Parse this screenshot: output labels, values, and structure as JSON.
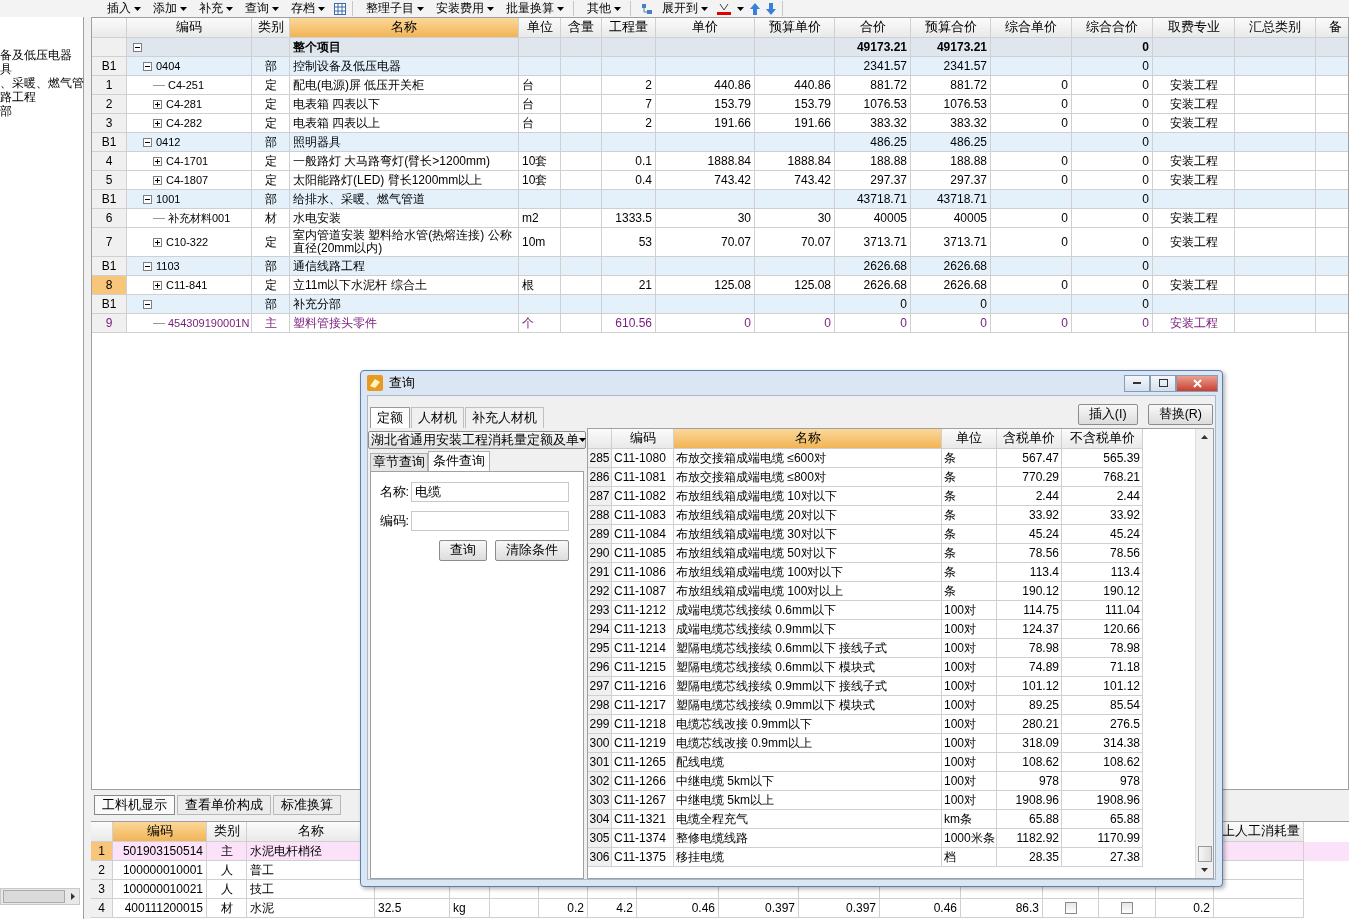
{
  "toolbar": {
    "groups": [
      [
        {
          "label": "插入",
          "dropdown": true
        },
        {
          "label": "添加",
          "dropdown": true
        },
        {
          "label": "补充",
          "dropdown": true
        },
        {
          "label": "查询",
          "dropdown": true
        },
        {
          "label": "存档",
          "dropdown": true
        }
      ],
      [
        {
          "label": "整理子目",
          "dropdown": true
        },
        {
          "label": "安装费用",
          "dropdown": true
        },
        {
          "label": "批量换算",
          "dropdown": true
        }
      ],
      [
        {
          "label": "其他",
          "dropdown": true
        }
      ],
      [
        {
          "label": "展开到",
          "dropdown": true
        }
      ]
    ]
  },
  "tree_panel": {
    "items": [
      "备及低压电器",
      "具",
      "、采暖、燃气管",
      "路工程",
      "部"
    ]
  },
  "estimate_table": {
    "columns": [
      {
        "label": "编码",
        "selected": false
      },
      {
        "label": "类别",
        "selected": false
      },
      {
        "label": "名称",
        "selected": true
      },
      {
        "label": "单位",
        "selected": false
      },
      {
        "label": "含量",
        "selected": false
      },
      {
        "label": "工程量",
        "selected": false
      },
      {
        "label": "单价",
        "selected": false
      },
      {
        "label": "预算单价",
        "selected": false
      },
      {
        "label": "合价",
        "selected": false
      },
      {
        "label": "预算合价",
        "selected": false
      },
      {
        "label": "综合单价",
        "selected": false
      },
      {
        "label": "综合合价",
        "selected": false
      },
      {
        "label": "取费专业",
        "selected": false
      },
      {
        "label": "汇总类别",
        "selected": false
      },
      {
        "label": "备",
        "selected": false
      }
    ],
    "root": {
      "kind": "total",
      "expanded": true,
      "selected": false,
      "name": "整个项目",
      "amount": "49173.21",
      "budget_amount": "49173.21",
      "comp_amount": "0",
      "children": [
        {
          "kind": "section",
          "row_no": "B1",
          "code": "0404",
          "type": "部",
          "name": "控制设备及低压电器",
          "expanded": true,
          "selected": false,
          "amount": "2341.57",
          "budget_amount": "2341.57",
          "comp_amount": "0",
          "children": [
            {
              "kind": "item",
              "row_no": "1",
              "code": "C4-251",
              "type": "定",
              "name": "配电(电源)屏 低压开关柜",
              "unit": "台",
              "qty": "2",
              "price": "440.86",
              "budget_price": "440.86",
              "amount": "881.72",
              "budget_amount": "881.72",
              "comp_price": "0",
              "comp_amount": "0",
              "fee": "安装工程",
              "selected": false
            },
            {
              "kind": "item",
              "row_no": "2",
              "code": "C4-281",
              "type": "定",
              "name": "电表箱 四表以下",
              "unit": "台",
              "qty": "7",
              "price": "153.79",
              "budget_price": "153.79",
              "amount": "1076.53",
              "budget_amount": "1076.53",
              "comp_price": "0",
              "comp_amount": "0",
              "fee": "安装工程",
              "expanded": false,
              "selected": false
            },
            {
              "kind": "item",
              "row_no": "3",
              "code": "C4-282",
              "type": "定",
              "name": "电表箱 四表以上",
              "unit": "台",
              "qty": "2",
              "price": "191.66",
              "budget_price": "191.66",
              "amount": "383.32",
              "budget_amount": "383.32",
              "comp_price": "0",
              "comp_amount": "0",
              "fee": "安装工程",
              "expanded": false,
              "selected": false
            }
          ]
        },
        {
          "kind": "section",
          "row_no": "B1",
          "code": "0412",
          "type": "部",
          "name": "照明器具",
          "expanded": true,
          "selected": false,
          "amount": "486.25",
          "budget_amount": "486.25",
          "comp_amount": "0",
          "children": [
            {
              "kind": "item",
              "row_no": "4",
              "code": "C4-1701",
              "type": "定",
              "name": "一般路灯 大马路弯灯(臂长>1200mm)",
              "unit": "10套",
              "qty": "0.1",
              "price": "1888.84",
              "budget_price": "1888.84",
              "amount": "188.88",
              "budget_amount": "188.88",
              "comp_price": "0",
              "comp_amount": "0",
              "fee": "安装工程",
              "expanded": false,
              "selected": false
            },
            {
              "kind": "item",
              "row_no": "5",
              "code": "C4-1807",
              "type": "定",
              "name": "太阳能路灯(LED) 臂长1200mm以上",
              "unit": "10套",
              "qty": "0.4",
              "price": "743.42",
              "budget_price": "743.42",
              "amount": "297.37",
              "budget_amount": "297.37",
              "comp_price": "0",
              "comp_amount": "0",
              "fee": "安装工程",
              "expanded": false,
              "selected": false
            }
          ]
        },
        {
          "kind": "section",
          "row_no": "B1",
          "code": "1001",
          "type": "部",
          "name": "给排水、采暖、燃气管道",
          "expanded": true,
          "selected": false,
          "amount": "43718.71",
          "budget_amount": "43718.71",
          "comp_amount": "0",
          "children": [
            {
              "kind": "item",
              "row_no": "6",
              "code": "补充材料001",
              "type": "材",
              "name": "水电安装",
              "unit": "m2",
              "qty": "1333.5",
              "price": "30",
              "budget_price": "30",
              "amount": "40005",
              "budget_amount": "40005",
              "comp_price": "0",
              "comp_amount": "0",
              "fee": "安装工程",
              "selected": false
            },
            {
              "kind": "item",
              "row_no": "7",
              "code": "C10-322",
              "type": "定",
              "name": "室内管道安装 塑料给水管(热熔连接) 公称直径(20mm以内)",
              "unit": "10m",
              "qty": "53",
              "price": "70.07",
              "budget_price": "70.07",
              "amount": "3713.71",
              "budget_amount": "3713.71",
              "comp_price": "0",
              "comp_amount": "0",
              "fee": "安装工程",
              "expanded": false,
              "selected": false
            }
          ]
        },
        {
          "kind": "section",
          "row_no": "B1",
          "code": "1103",
          "type": "部",
          "name": "通信线路工程",
          "expanded": true,
          "selected": false,
          "amount": "2626.68",
          "budget_amount": "2626.68",
          "comp_amount": "0",
          "children": [
            {
              "kind": "item",
              "row_no": "8",
              "code": "C11-841",
              "type": "定",
              "name": "立11m以下水泥杆 综合土",
              "unit": "根",
              "qty": "21",
              "price": "125.08",
              "budget_price": "125.08",
              "amount": "2626.68",
              "budget_amount": "2626.68",
              "comp_price": "0",
              "comp_amount": "0",
              "fee": "安装工程",
              "expanded": false,
              "selected": true
            }
          ]
        },
        {
          "kind": "section",
          "row_no": "B1",
          "type": "部",
          "name": "补充分部",
          "expanded": true,
          "selected": false,
          "amount": "0",
          "budget_amount": "0",
          "comp_amount": "0",
          "children": [
            {
              "kind": "material",
              "row_no": "9",
              "code": "454309190001N",
              "type": "主",
              "name": "塑料管接头零件",
              "unit": "个",
              "qty": "610.56",
              "price": "0",
              "budget_price": "0",
              "amount": "0",
              "budget_amount": "0",
              "comp_price": "0",
              "comp_amount": "0",
              "fee": "安装工程",
              "selected": false
            }
          ]
        }
      ]
    }
  },
  "resource_panel": {
    "tabs": [
      {
        "label": "工料机显示",
        "selected": true
      },
      {
        "label": "查看单价构成",
        "selected": false
      },
      {
        "label": "标准换算",
        "selected": false
      }
    ],
    "columns": [
      {
        "label": "编码",
        "selected": true
      },
      {
        "label": "类别",
        "selected": false
      },
      {
        "label": "名称",
        "selected": false
      }
    ],
    "extra_column": {
      "label": "上人工消耗量"
    },
    "rows": [
      {
        "row_no": "1",
        "code": "501903150514",
        "type": "主",
        "name": "水泥电杆梢径",
        "selected": true
      },
      {
        "row_no": "2",
        "code": "100000010001",
        "type": "人",
        "name": "普工",
        "selected": false
      },
      {
        "row_no": "3",
        "code": "100000010021",
        "type": "人",
        "name": "技工",
        "selected": false
      },
      {
        "row_no": "4",
        "code": "400111200015",
        "type": "材",
        "name": "水泥",
        "spec": "32.5",
        "unit": "kg",
        "values": [
          "0.2",
          "4.2",
          "0.46",
          "0.397",
          "0.397",
          "0.46",
          "86.3"
        ],
        "check_1": false,
        "check_2": false,
        "last": "0.2",
        "selected": false
      }
    ]
  },
  "query_dialog": {
    "title": "查询",
    "tabs": [
      {
        "label": "定额",
        "selected": true
      },
      {
        "label": "人材机",
        "selected": false
      },
      {
        "label": "补充人材机",
        "selected": false
      }
    ],
    "buttons": [
      "插入(I)",
      "替换(R)"
    ],
    "library": "湖北省通用安装工程消耗量定额及单",
    "search_tabs": [
      {
        "label": "章节查询",
        "selected": false
      },
      {
        "label": "条件查询",
        "selected": true
      }
    ],
    "fields": [
      {
        "label": "名称:",
        "value": "电缆"
      },
      {
        "label": "编码:"
      }
    ],
    "actions": [
      "查询",
      "清除条件"
    ],
    "results": {
      "columns": [
        {
          "label": "编码",
          "selected": false
        },
        {
          "label": "名称",
          "selected": true
        },
        {
          "label": "单位",
          "selected": false
        },
        {
          "label": "含税单价",
          "selected": false
        },
        {
          "label": "不含税单价",
          "selected": false
        }
      ],
      "rows": [
        {
          "row_no": "285",
          "cells": [
            "C11-1080",
            "布放交接箱成端电缆 ≤600对",
            "条",
            "567.47",
            "565.39"
          ]
        },
        {
          "row_no": "286",
          "cells": [
            "C11-1081",
            "布放交接箱成端电缆 ≤800对",
            "条",
            "770.29",
            "768.21"
          ]
        },
        {
          "row_no": "287",
          "cells": [
            "C11-1082",
            "布放组线箱成端电缆 10对以下",
            "条",
            "2.44",
            "2.44"
          ]
        },
        {
          "row_no": "288",
          "cells": [
            "C11-1083",
            "布放组线箱成端电缆 20对以下",
            "条",
            "33.92",
            "33.92"
          ]
        },
        {
          "row_no": "289",
          "cells": [
            "C11-1084",
            "布放组线箱成端电缆 30对以下",
            "条",
            "45.24",
            "45.24"
          ]
        },
        {
          "row_no": "290",
          "cells": [
            "C11-1085",
            "布放组线箱成端电缆 50对以下",
            "条",
            "78.56",
            "78.56"
          ]
        },
        {
          "row_no": "291",
          "cells": [
            "C11-1086",
            "布放组线箱成端电缆 100对以下",
            "条",
            "113.4",
            "113.4"
          ]
        },
        {
          "row_no": "292",
          "cells": [
            "C11-1087",
            "布放组线箱成端电缆 100对以上",
            "条",
            "190.12",
            "190.12"
          ]
        },
        {
          "row_no": "293",
          "cells": [
            "C11-1212",
            "成端电缆芯线接续 0.6mm以下",
            "100对",
            "114.75",
            "111.04"
          ]
        },
        {
          "row_no": "294",
          "cells": [
            "C11-1213",
            "成端电缆芯线接续 0.9mm以下",
            "100对",
            "124.37",
            "120.66"
          ]
        },
        {
          "row_no": "295",
          "cells": [
            "C11-1214",
            "塑隔电缆芯线接续 0.6mm以下 接线子式",
            "100对",
            "78.98",
            "78.98"
          ]
        },
        {
          "row_no": "296",
          "cells": [
            "C11-1215",
            "塑隔电缆芯线接续 0.6mm以下 模块式",
            "100对",
            "74.89",
            "71.18"
          ]
        },
        {
          "row_no": "297",
          "cells": [
            "C11-1216",
            "塑隔电缆芯线接续 0.9mm以下 接线子式",
            "100对",
            "101.12",
            "101.12"
          ]
        },
        {
          "row_no": "298",
          "cells": [
            "C11-1217",
            "塑隔电缆芯线接续 0.9mm以下 模块式",
            "100对",
            "89.25",
            "85.54"
          ]
        },
        {
          "row_no": "299",
          "cells": [
            "C11-1218",
            "电缆芯线改接 0.9mm以下",
            "100对",
            "280.21",
            "276.5"
          ]
        },
        {
          "row_no": "300",
          "cells": [
            "C11-1219",
            "电缆芯线改接 0.9mm以上",
            "100对",
            "318.09",
            "314.38"
          ]
        },
        {
          "row_no": "301",
          "cells": [
            "C11-1265",
            "配线电缆",
            "100对",
            "108.62",
            "108.62"
          ]
        },
        {
          "row_no": "302",
          "cells": [
            "C11-1266",
            "中继电缆 5km以下",
            "100对",
            "978",
            "978"
          ]
        },
        {
          "row_no": "303",
          "cells": [
            "C11-1267",
            "中继电缆 5km以上",
            "100对",
            "1908.96",
            "1908.96"
          ]
        },
        {
          "row_no": "304",
          "cells": [
            "C11-1321",
            "电缆全程充气",
            "km条",
            "65.88",
            "65.88"
          ]
        },
        {
          "row_no": "305",
          "cells": [
            "C11-1374",
            "整修电缆线路",
            "1000米条",
            "1182.92",
            "1170.99"
          ]
        },
        {
          "row_no": "306",
          "cells": [
            "C11-1375",
            "移挂电缆",
            "档",
            "28.35",
            "27.38"
          ]
        }
      ]
    }
  }
}
